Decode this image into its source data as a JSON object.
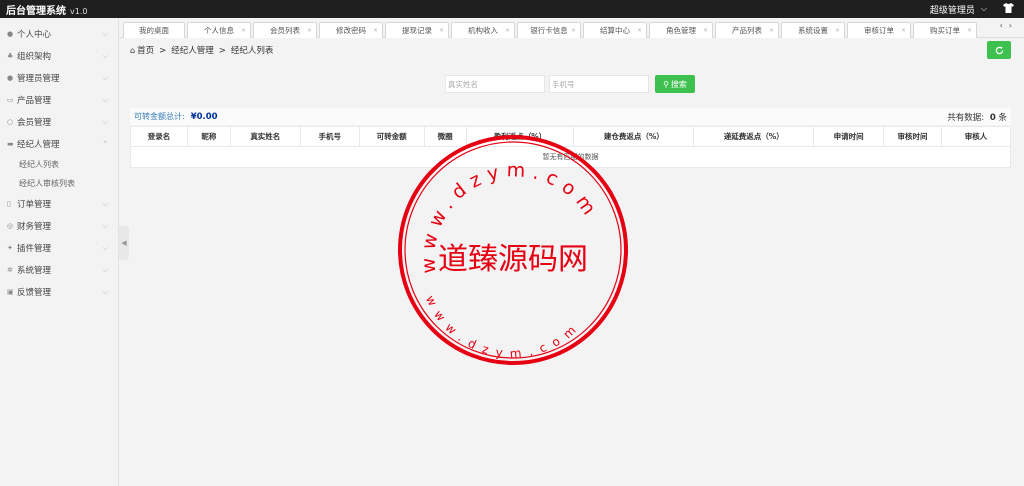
{
  "header": {
    "title": "后台管理系统",
    "version": "v1.0",
    "user": "超级管理员"
  },
  "sidebar": {
    "items": [
      {
        "label": "个人中心"
      },
      {
        "label": "组织架构"
      },
      {
        "label": "管理员管理"
      },
      {
        "label": "产品管理"
      },
      {
        "label": "会员管理"
      },
      {
        "label": "经纪人管理"
      },
      {
        "label": "订单管理"
      },
      {
        "label": "财务管理"
      },
      {
        "label": "插件管理"
      },
      {
        "label": "系统管理"
      },
      {
        "label": "反馈管理"
      }
    ],
    "subitems": [
      {
        "label": "经纪人列表"
      },
      {
        "label": "经纪人审核列表"
      }
    ]
  },
  "tabs": [
    {
      "label": "我的桌面"
    },
    {
      "label": "个人信息"
    },
    {
      "label": "会员列表"
    },
    {
      "label": "修改密码"
    },
    {
      "label": "提现记录"
    },
    {
      "label": "机构收入"
    },
    {
      "label": "银行卡信息"
    },
    {
      "label": "结算中心"
    },
    {
      "label": "角色管理"
    },
    {
      "label": "产品列表"
    },
    {
      "label": "系统设置"
    },
    {
      "label": "审核订单"
    },
    {
      "label": "购买订单"
    }
  ],
  "breadcrumb": {
    "home": "首页",
    "level1": "经纪人管理",
    "level2": "经纪人列表"
  },
  "search": {
    "name_placeholder": "真实姓名",
    "phone_placeholder": "手机号",
    "button_label": "搜索"
  },
  "summary": {
    "label": "可转金额总计:",
    "amount": "¥0.00",
    "total_label": "共有数据:",
    "total_count": "0",
    "total_unit": "条"
  },
  "table": {
    "columns": [
      "登录名",
      "昵称",
      "真实姓名",
      "手机号",
      "可转金额",
      "微圈",
      "盈利返点（%）",
      "建仓费返点（%）",
      "递延费返点（%）",
      "申请时间",
      "审核时间",
      "审核人"
    ],
    "empty_text": "暂无有匹配的数据"
  },
  "watermark": {
    "text": "道臻源码网",
    "url_top": "www.dzym.com",
    "url_bottom": "www.dzym.com"
  },
  "colors": {
    "accent_green": "#3ec04f",
    "stamp_red": "#e60012",
    "link_blue": "#337ab7"
  }
}
